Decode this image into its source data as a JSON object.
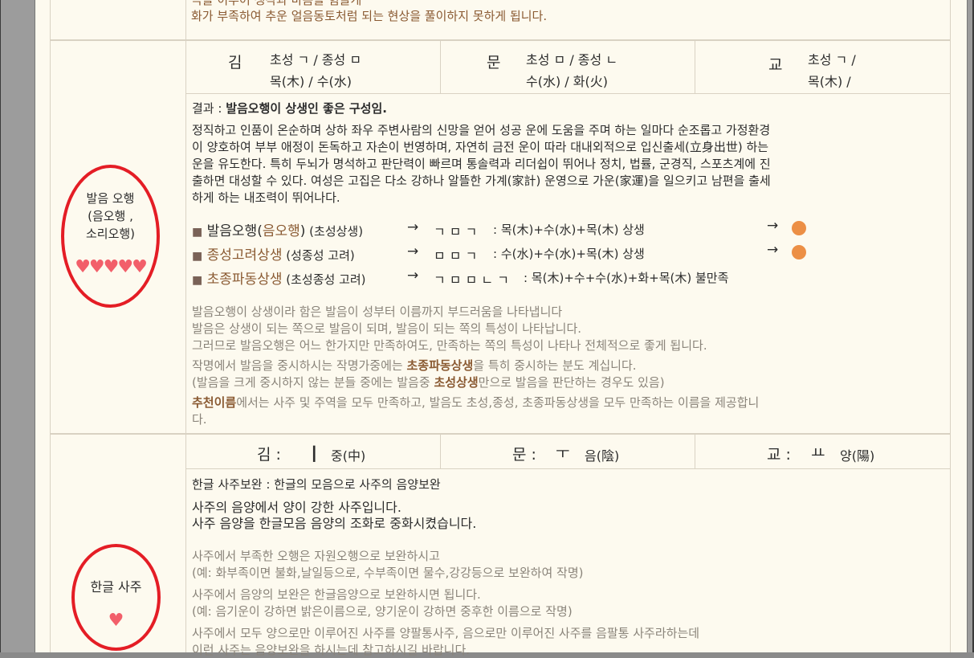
{
  "top": {
    "line1": "극을 이루어 생각과 마음을 힘들게",
    "line2": "화가 부족하여 추운 얼음동토처럼 되는 현상을 풀이하지 못하게 됩니다."
  },
  "pron": {
    "label": [
      "발음 오행",
      "(음오행 ,",
      "소리오행)"
    ],
    "hearts": "♥♥♥♥♥",
    "chars": [
      {
        "char": "김",
        "l1": "초성 ㄱ / 종성 ㅁ",
        "l2": "목(木)   / 수(水)"
      },
      {
        "char": "문",
        "l1": "초성 ㅁ / 종성 ㄴ",
        "l2": "수(水)   / 화(火)"
      },
      {
        "char": "교",
        "l1": "초성 ㄱ /",
        "l2": "목(木)   /"
      }
    ],
    "result_prefix": "결과 : ",
    "result_text": "발음오행이 상생인 좋은 구성임.",
    "desc": [
      "정직하고 인품이 온순하며 상하 좌우 주변사람의 신망을 얻어 성공 운에 도움을 주며 하는 일마다 순조롭고 가정환경",
      "이 양호하여 부부 애정이 돈독하고 자손이 번영하며, 자연히 금전 운이 따라 대내외적으로 입신출세(立身出世) 하는",
      "운을 유도한다. 특히 두뇌가 명석하고 판단력이 빠르며 통솔력과 리더쉽이 뛰어나 정치, 법률, 군경직, 스포츠계에 진",
      "출하면 대성할 수 있다. 여성은 고집은 다소 강하나 알뜰한 가계(家計) 운영으로 가운(家運)을 일으키고 남편을 출세",
      "하게 하는 내조력이 뛰어나다."
    ],
    "rows": [
      {
        "a": "발음오행(",
        "b": "음오행",
        "c": ")",
        "d": " (초성상생)",
        "arrow": "→",
        "jamo": "ㄱ ㅁ ㄱ",
        "calc": ": 목(木)+수(水)+목(木) 상생",
        "mark": "→"
      },
      {
        "a": "종성고려상생",
        "b": "",
        "c": "",
        "d": " (성종성 고려)",
        "arrow": "→",
        "jamo": "ㅁ ㅁ ㄱ",
        "calc": ": 수(水)+수(水)+목(木) 상생",
        "mark": "→"
      },
      {
        "a": "초종파동상생",
        "b": "",
        "c": "",
        "d": " (초성종성 고려)",
        "arrow": "→",
        "jamo": "ㄱ ㅁ ㅁ ㄴ ㄱ",
        "calc": ": 목(木)+수+수(水)+화+목(木) 불만족",
        "mark": ""
      }
    ],
    "notes": [
      "발음오행이 상생이라 함은    발음이 성부터 이름까지 부드러움을 나타냅니다",
      "발음은 상생이 되는 쪽으로 발음이 되며, 발음이 되는 쪽의 특성이 나타납니다.",
      "그러므로 발음오행은 어느 한가지만 만족하여도, 만족하는 쪽의 특성이 나타나 전체적으로 좋게 됩니다."
    ],
    "note4a": "작명에서 발음을 중시하시는 작명가중에는    ",
    "note4b": "초종파동상생",
    "note4c": "을 특히 중시하는 분도 계십니다.",
    "note5a": "(발음을 크게 중시하지 않는 분들 중에는 발음중 ",
    "note5b": "초성상생",
    "note5c": "만으로 발음을 판단하는 경우도 있음)",
    "note6a": "추천이름",
    "note6b": "에서는 사주 및 주역을 모두 만족하고, 발음도 초성,종성, 초종파동상생을 모두 만족하는 이름을 제공합니",
    "note6c": "다."
  },
  "hangul": {
    "label": "한글 사주",
    "heart": "♥",
    "vowels": [
      {
        "char": "김 :",
        "v": "ㅣ",
        "t": "중(中)"
      },
      {
        "char": "문 :",
        "v": "ㅜ",
        "t": "음(陰)"
      },
      {
        "char": "교 :",
        "v": "ㅛ",
        "t": "양(陽)"
      }
    ],
    "title": "한글 사주보완 : 한글의 모음으로 사주의 음양보완",
    "l1": "사주의 음양에서 양이 강한 사주입니다.",
    "l2": "사주 음양을 한글모음 음양의 조화로 중화시켰습니다.",
    "notes": [
      "사주에서 부족한 오행은 자원오행으로 보완하시고",
      "(예: 화부족이면 불화,날일등으로, 수부족이면 물수,강강등으로 보완하여 작명)",
      "사주에서 음양의 보완은 한글음양으로 보완하시면 됩니다.",
      "(예: 음기운이 강하면 밝은이름으로, 양기운이 강하면 중후한 이름으로 작명)",
      "사주에서 모두 양으로만 이루어진 사주를 양팔통사주, 음으로만 이루어진 사주를 음팔통 사주라하는데",
      "이런 사주는 음양보완을 하시는데 참고하시길 바랍니다."
    ]
  }
}
